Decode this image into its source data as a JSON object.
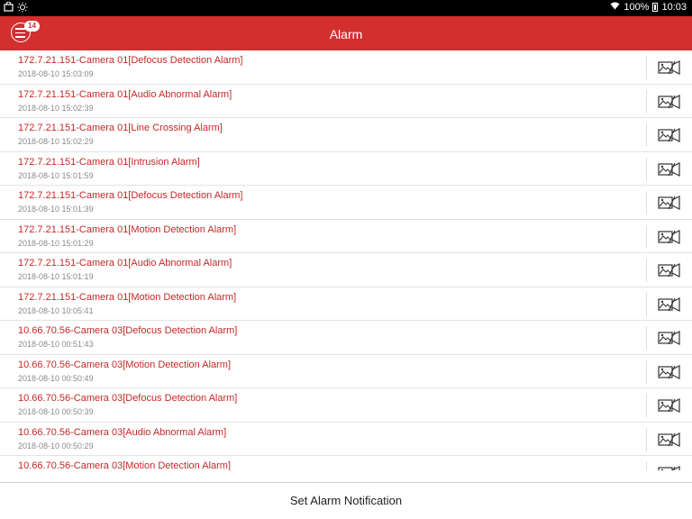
{
  "status_bar": {
    "battery": "100%",
    "time": "10:03"
  },
  "header": {
    "title": "Alarm",
    "badge": "14"
  },
  "alarms": [
    {
      "title": "172.7.21.151-Camera 01[Defocus Detection Alarm]",
      "time": "2018-08-10 15:03:09"
    },
    {
      "title": "172.7.21.151-Camera 01[Audio Abnormal Alarm]",
      "time": "2018-08-10 15:02:39"
    },
    {
      "title": "172.7.21.151-Camera 01[Line Crossing Alarm]",
      "time": "2018-08-10 15:02:29"
    },
    {
      "title": "172.7.21.151-Camera 01[Intrusion Alarm]",
      "time": "2018-08-10 15:01:59"
    },
    {
      "title": "172.7.21.151-Camera 01[Defocus Detection Alarm]",
      "time": "2018-08-10 15:01:39"
    },
    {
      "title": "172.7.21.151-Camera 01[Motion Detection Alarm]",
      "time": "2018-08-10 15:01:29"
    },
    {
      "title": "172.7.21.151-Camera 01[Audio Abnormal Alarm]",
      "time": "2018-08-10 15:01:19"
    },
    {
      "title": "172.7.21.151-Camera 01[Motion Detection Alarm]",
      "time": "2018-08-10 10:05:41"
    },
    {
      "title": "10.66.70.56-Camera 03[Defocus Detection Alarm]",
      "time": "2018-08-10 00:51:43"
    },
    {
      "title": "10.66.70.56-Camera 03[Motion Detection Alarm]",
      "time": "2018-08-10 00:50:49"
    },
    {
      "title": "10.66.70.56-Camera 03[Defocus Detection Alarm]",
      "time": "2018-08-10 00:50:39"
    },
    {
      "title": "10.66.70.56-Camera 03[Audio Abnormal Alarm]",
      "time": "2018-08-10 00:50:29"
    },
    {
      "title": "10.66.70.56-Camera 03[Motion Detection Alarm]",
      "time": ""
    }
  ],
  "footer": {
    "button_label": "Set Alarm Notification"
  },
  "colors": {
    "accent": "#d32f2f",
    "alarm_text": "#c62828"
  },
  "icons": {
    "menu": "menu-icon",
    "row_action": "image-video-icon"
  }
}
